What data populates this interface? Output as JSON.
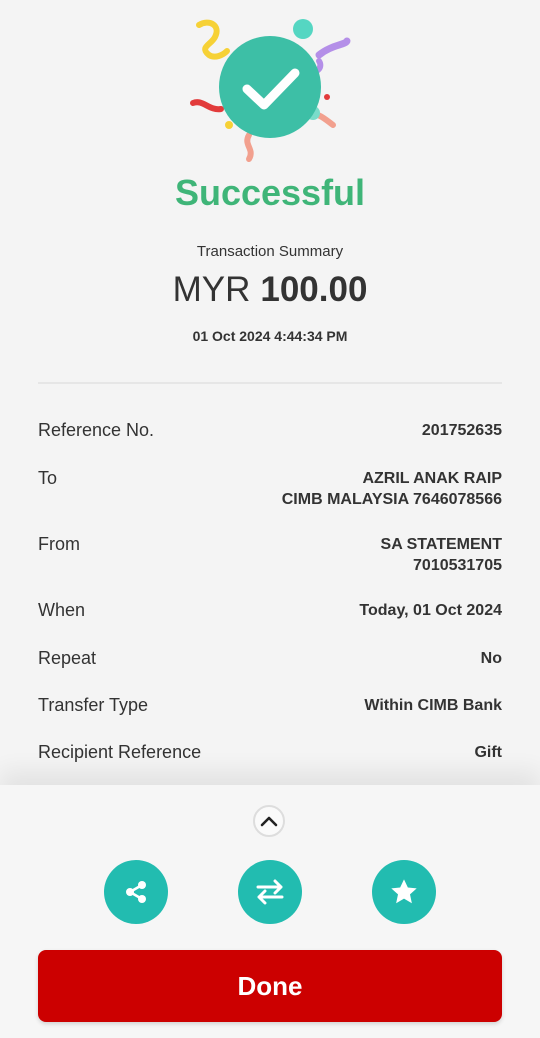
{
  "status": {
    "title": "Successful"
  },
  "summary": {
    "label": "Transaction Summary",
    "currency": "MYR",
    "amount": "100.00",
    "datetime": "01 Oct 2024 4:44:34 PM"
  },
  "details": {
    "reference": {
      "label": "Reference No.",
      "value": "201752635"
    },
    "to": {
      "label": "To",
      "line1": "AZRIL ANAK RAIP",
      "line2": "CIMB MALAYSIA 7646078566"
    },
    "from": {
      "label": "From",
      "line1": "SA STATEMENT",
      "line2": "7010531705"
    },
    "when": {
      "label": "When",
      "value": "Today, 01 Oct 2024"
    },
    "repeat": {
      "label": "Repeat",
      "value": "No"
    },
    "transfer_type": {
      "label": "Transfer Type",
      "value": "Within CIMB Bank"
    },
    "recipient_reference": {
      "label": "Recipient Reference",
      "value": "Gift"
    }
  },
  "actions": {
    "icons": [
      "share-icon",
      "transfer-icon",
      "star-icon"
    ],
    "done_label": "Done"
  },
  "colors": {
    "success": "#3fb578",
    "check_circle": "#3dbfa6",
    "action_teal": "#22bcb0",
    "done_red": "#cc0000"
  }
}
